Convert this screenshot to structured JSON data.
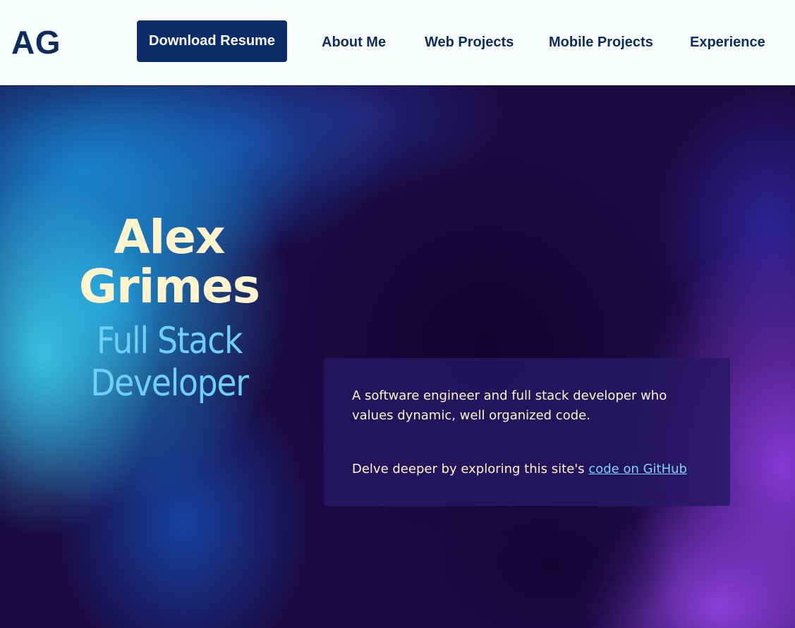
{
  "nav": {
    "logo": "AG",
    "resume_button": "Download Resume",
    "links": [
      "About Me",
      "Web Projects",
      "Mobile Projects",
      "Experience"
    ]
  },
  "hero": {
    "first_name": "Alex",
    "last_name": "Grimes",
    "role_line_1": "Full Stack",
    "role_line_2": "Developer"
  },
  "intro": {
    "description": "A software engineer and full stack developer who values dynamic, well organized code.",
    "explore_prefix": "Delve deeper by exploring this site's ",
    "github_link_text": "code on GitHub"
  },
  "colors": {
    "nav_background": "#f8fdfe",
    "nav_text": "#0d2c5e",
    "button_background": "#0b2c66",
    "name_color": "#fff4cc",
    "role_color": "#6ecff7",
    "link_color": "#7fd1f5",
    "hero_base": "#1a0a44"
  }
}
